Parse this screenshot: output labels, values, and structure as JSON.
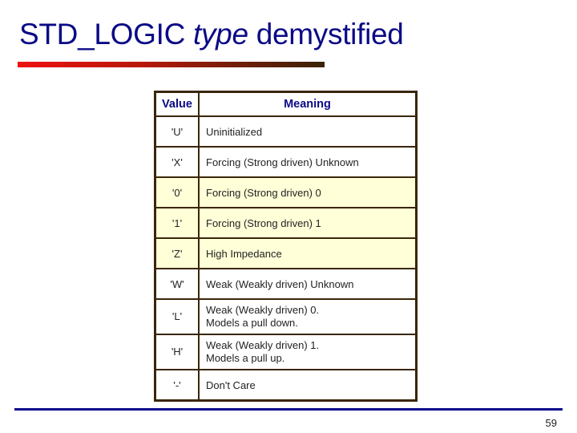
{
  "slide": {
    "title_part1": "STD_LOGIC ",
    "title_part2": "type",
    "title_part3": " demystified",
    "page_number": "59",
    "colors": {
      "title": "#0a0a86",
      "title_bar_start": "#ee1111",
      "title_bar_end": "#3a2206",
      "table_border": "#3a2608",
      "highlight_row": "#ffffd8",
      "bottom_bar": "#0a0a8c"
    }
  },
  "table": {
    "headers": [
      "Value",
      "Meaning"
    ],
    "rows": [
      {
        "value": "'U'",
        "meaning": [
          "Uninitialized"
        ],
        "highlighted": false
      },
      {
        "value": "'X'",
        "meaning": [
          "Forcing (Strong driven) Unknown"
        ],
        "highlighted": false
      },
      {
        "value": "'0'",
        "meaning": [
          "Forcing (Strong driven) 0"
        ],
        "highlighted": true
      },
      {
        "value": "'1'",
        "meaning": [
          "Forcing (Strong driven) 1"
        ],
        "highlighted": true
      },
      {
        "value": "'Z'",
        "meaning": [
          "High Impedance"
        ],
        "highlighted": true
      },
      {
        "value": "'W'",
        "meaning": [
          "Weak (Weakly driven) Unknown"
        ],
        "highlighted": false
      },
      {
        "value": "'L'",
        "meaning": [
          "Weak (Weakly driven) 0.",
          "Models a pull down."
        ],
        "highlighted": false
      },
      {
        "value": "'H'",
        "meaning": [
          "Weak (Weakly driven) 1.",
          "Models a pull up."
        ],
        "highlighted": false
      },
      {
        "value": "'-'",
        "meaning": [
          "Don't Care"
        ],
        "highlighted": false
      }
    ]
  }
}
